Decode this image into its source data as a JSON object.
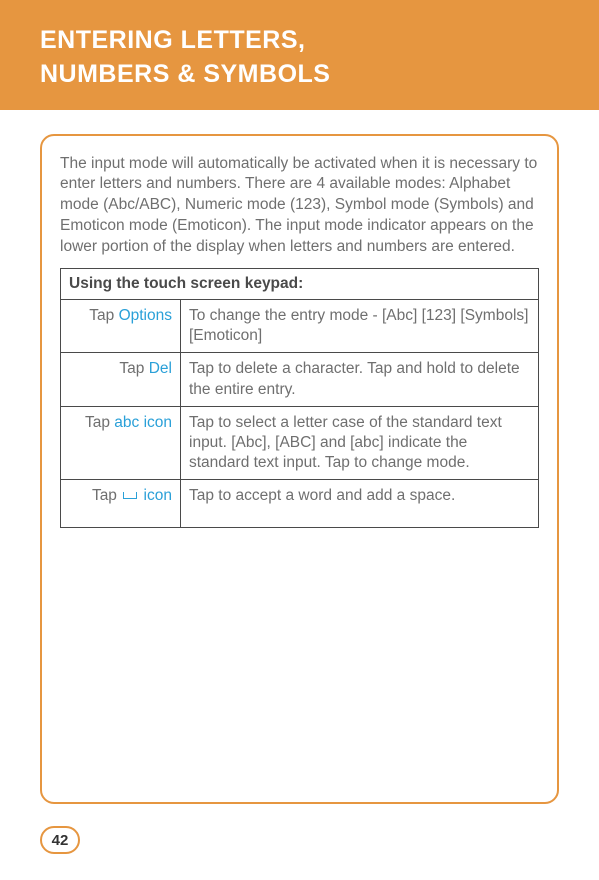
{
  "header": {
    "title_line1": "ENTERING LETTERS,",
    "title_line2": "NUMBERS & SYMBOLS"
  },
  "intro": "The input mode will automatically be activated when it is necessary to enter letters and numbers. There are 4 available modes: Alphabet mode (Abc/ABC), Numeric mode (123), Symbol mode (Symbols) and Emoticon mode (Emoticon). The input mode indicator appears on the lower portion of the display when letters and numbers are entered.",
  "table": {
    "heading": "Using the touch screen keypad:",
    "rows": [
      {
        "prefix": "Tap ",
        "keyword": "Options",
        "suffix": "",
        "desc": "To change the entry mode - [Abc] [123] [Symbols] [Emoticon]"
      },
      {
        "prefix": "Tap ",
        "keyword": "Del",
        "suffix": "",
        "desc": "Tap to delete a character. Tap and hold to delete the entire entry."
      },
      {
        "prefix": "Tap ",
        "keyword": "abc icon",
        "suffix": "",
        "desc": "Tap to select a letter case of the standard text input. [Abc], [ABC] and [abc] indicate the standard text input. Tap to change mode."
      },
      {
        "prefix": "Tap ",
        "keyword": "",
        "suffix": " icon",
        "desc": "Tap to accept a word and add a space."
      }
    ]
  },
  "page_number": "42"
}
